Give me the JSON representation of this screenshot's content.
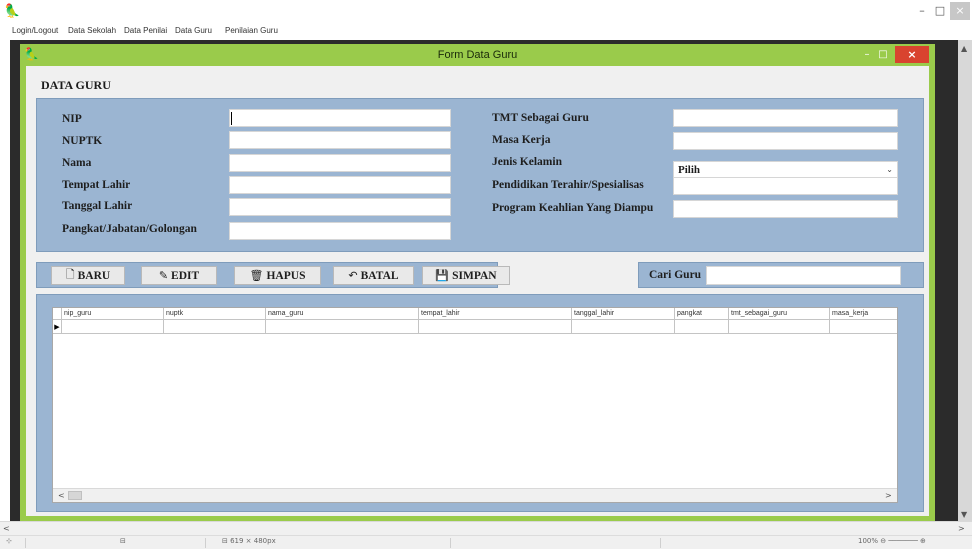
{
  "app": {
    "icon": "app-icon",
    "menu": [
      "Login/Logout",
      "Data Sekolah",
      "Data Penilai",
      "Data Guru",
      "Penilaian Guru"
    ],
    "min_label": "–",
    "max_label": "□",
    "close_label": "×"
  },
  "form": {
    "title": "Form Data Guru",
    "icon": "form-icon",
    "min_label": "–",
    "max_label": "□",
    "close_label": "×",
    "section_title": "DATA GURU",
    "left_fields": [
      {
        "label": "NIP",
        "value": ""
      },
      {
        "label": "NUPTK",
        "value": ""
      },
      {
        "label": "Nama",
        "value": ""
      },
      {
        "label": "Tempat Lahir",
        "value": ""
      },
      {
        "label": "Tanggal Lahir",
        "value": ""
      },
      {
        "label": "Pangkat/Jabatan/Golongan",
        "value": ""
      }
    ],
    "right_fields": [
      {
        "label": "TMT Sebagai Guru",
        "value": ""
      },
      {
        "label": "Masa Kerja",
        "value": ""
      },
      {
        "label": "Jenis Kelamin",
        "value": "Pilih"
      },
      {
        "label": "Pendidikan Terahir/Spesialisas",
        "value": ""
      },
      {
        "label": "Program Keahlian Yang Diampu",
        "value": ""
      }
    ],
    "buttons": [
      {
        "label": "BARU",
        "icon": "new-icon",
        "glyph": "🗋"
      },
      {
        "label": "EDIT",
        "icon": "edit-icon",
        "glyph": "✎"
      },
      {
        "label": "HAPUS",
        "icon": "delete-icon",
        "glyph": "🗑"
      },
      {
        "label": "BATAL",
        "icon": "cancel-icon",
        "glyph": "↶"
      },
      {
        "label": "SIMPAN",
        "icon": "save-icon",
        "glyph": "💾"
      }
    ],
    "search": {
      "label": "Cari Guru",
      "value": ""
    },
    "grid": {
      "columns": [
        "nip_guru",
        "nuptk",
        "nama_guru",
        "tempat_lahir",
        "tanggal_lahir",
        "pangkat",
        "tmt_sebagai_guru",
        "masa_kerja"
      ],
      "row_indicator": "▶"
    }
  },
  "status": {
    "items": [
      "⊹",
      "⊟",
      "⊟ 619 × 480px",
      "",
      "100% ⊖ ─────── ⊕"
    ]
  },
  "colors": {
    "form_frame": "#9acb4b",
    "panel": "#9bb5d2",
    "close_button": "#d9432f"
  }
}
